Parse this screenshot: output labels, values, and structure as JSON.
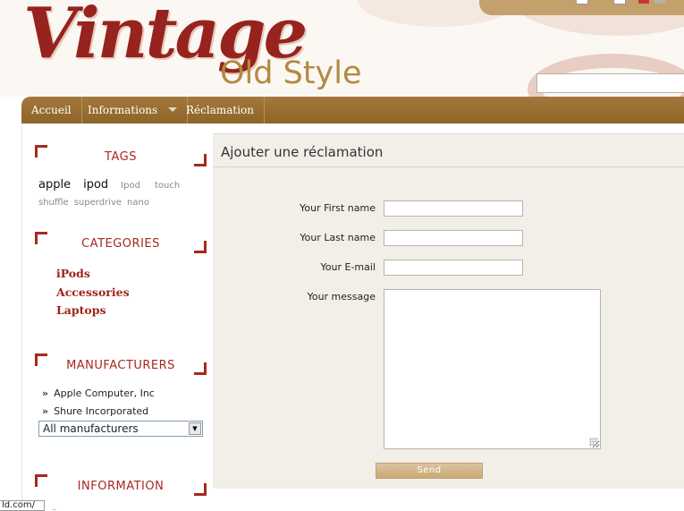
{
  "header": {
    "logo_main": "Vintage",
    "logo_sub": "Old Style",
    "search_value": ""
  },
  "nav": {
    "items": [
      {
        "label": "Accueil"
      },
      {
        "label": "Informations"
      },
      {
        "label": "Réclamation"
      }
    ]
  },
  "sidebar": {
    "tags": {
      "title": "TAGS",
      "items": [
        "apple",
        "ipod",
        "Ipod",
        "touch",
        "shuffle",
        "superdrive",
        "nano"
      ]
    },
    "categories": {
      "title": "CATEGORIES",
      "items": [
        "iPods",
        "Accessories",
        "Laptops"
      ]
    },
    "manufacturers": {
      "title": "MANUFACTURERS",
      "items": [
        "Apple Computer, Inc",
        "Shure Incorporated"
      ],
      "select_value": "All manufacturers"
    },
    "information": {
      "title": "INFORMATION"
    }
  },
  "form": {
    "title": "Ajouter une réclamation",
    "first_name_label": "Your First name",
    "last_name_label": "Your Last name",
    "email_label": "Your E-mail",
    "message_label": "Your message",
    "first_name_value": "",
    "last_name_value": "",
    "email_value": "",
    "message_value": "",
    "send_label": "Send"
  },
  "status": {
    "link_text": "ld.com/",
    "dots": ".."
  },
  "colors": {
    "brand_red": "#97231e",
    "brand_gold": "#b38943",
    "nav_bg": "#9a6f33",
    "form_bg": "#f2efe9"
  }
}
